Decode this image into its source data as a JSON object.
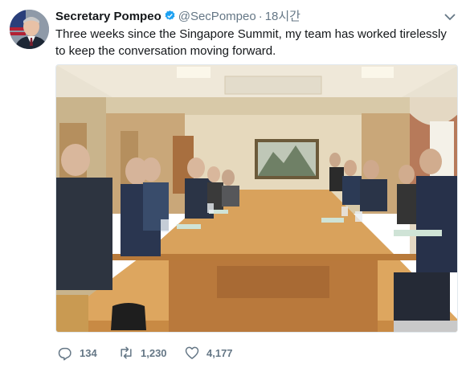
{
  "tweet": {
    "display_name": "Secretary Pompeo",
    "handle": "@SecPompeo",
    "separator": "·",
    "timestamp": "18시간",
    "text": "Three weeks since the Singapore Summit, my team has worked tirelessly to keep the conversation moving forward.",
    "verified": true,
    "avatar_icon": "profile-photo",
    "media_icon": "meeting-room-photo"
  },
  "actions": {
    "reply_count": "134",
    "retweet_count": "1,230",
    "like_count": "4,177"
  },
  "colors": {
    "text": "#14171a",
    "secondary": "#657786",
    "verified_blue": "#1da1f2"
  }
}
